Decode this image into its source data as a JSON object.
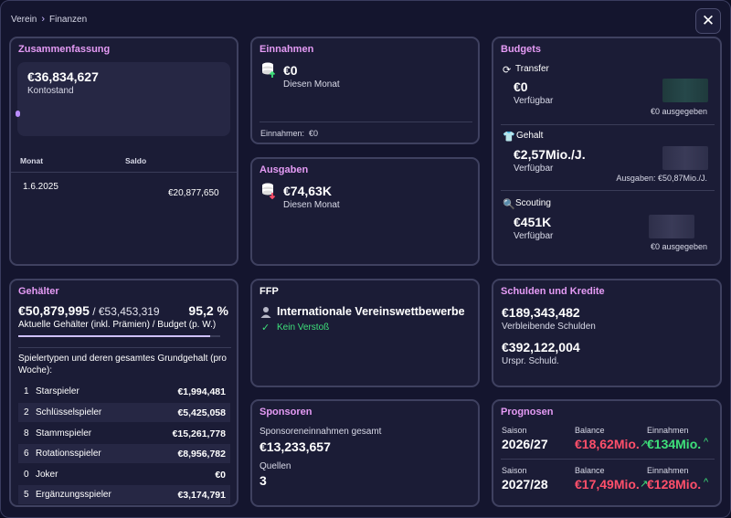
{
  "breadcrumb": {
    "root": "Verein",
    "current": "Finanzen"
  },
  "close_label": "✕",
  "summary": {
    "title": "Zusammenfassung",
    "balance": "€36,834,627",
    "balance_label": "Kontostand",
    "col_month": "Monat",
    "col_saldo": "Saldo",
    "rows": [
      {
        "month": "1.6.2025",
        "saldo": "€20,877,650"
      }
    ]
  },
  "income": {
    "title": "Einnahmen",
    "amount": "€0",
    "period": "Diesen Monat",
    "footer": "Einnahmen:  €0"
  },
  "expenses": {
    "title": "Ausgaben",
    "amount": "€74,63K",
    "period": "Diesen Monat"
  },
  "budgets": {
    "title": "Budgets",
    "items": [
      {
        "name": "Transfer",
        "amount": "€0",
        "label": "Verfügbar",
        "note": "€0 ausgegeben",
        "icon": "refresh-icon"
      },
      {
        "name": "Gehalt",
        "amount": "€2,57Mio./J.",
        "label": "Verfügbar",
        "note": "Ausgaben: €50,87Mio./J.",
        "icon": "shirt-icon"
      },
      {
        "name": "Scouting",
        "amount": "€451K",
        "label": "Verfügbar",
        "note": "€0 ausgegeben",
        "icon": "magnifier-icon"
      }
    ]
  },
  "salaries": {
    "title": "Gehälter",
    "current": "€50,879,995",
    "budget": " / €53,453,319",
    "percent": "95,2 %",
    "progress": 0.952,
    "caption": "Aktuelle Gehälter (inkl. Prämien) / Budget (p. W.)",
    "types_caption": "Spielertypen und deren gesamtes Grundgehalt (pro Woche):",
    "rows": [
      {
        "count": "1",
        "type": "Starspieler",
        "value": "€1,994,481"
      },
      {
        "count": "2",
        "type": "Schlüsselspieler",
        "value": "€5,425,058"
      },
      {
        "count": "8",
        "type": "Stammspieler",
        "value": "€15,261,778"
      },
      {
        "count": "6",
        "type": "Rotationsspieler",
        "value": "€8,956,782"
      },
      {
        "count": "0",
        "type": "Joker",
        "value": "€0"
      },
      {
        "count": "5",
        "type": "Ergänzungsspieler",
        "value": "€3,174,791"
      }
    ]
  },
  "ffp": {
    "title": "FFP",
    "competition": "Internationale Vereinswettbewerbe",
    "status": "Kein Verstoß"
  },
  "sponsors": {
    "title": "Sponsoren",
    "total_label": "Sponsoreneinnahmen gesamt",
    "total": "€13,233,657",
    "sources_label": "Quellen",
    "sources": "3"
  },
  "debts": {
    "title": "Schulden und Kredite",
    "remaining": "€189,343,482",
    "remaining_label": "Verbleibende Schulden",
    "original": "€392,122,004",
    "original_label": "Urspr. Schuld."
  },
  "forecast": {
    "title": "Prognosen",
    "season_label": "Saison",
    "balance_label": "Balance",
    "income_label": "Einnahmen",
    "rows": [
      {
        "season": "2026/27",
        "balance": "€18,62Mio.",
        "income": "€134Mio."
      },
      {
        "season": "2027/28",
        "balance": "€17,49Mio.",
        "income": "€128Mio."
      }
    ]
  },
  "colors": {
    "accent": "#e59bf5",
    "negative": "#ff4f6a",
    "positive": "#3ee07a"
  }
}
